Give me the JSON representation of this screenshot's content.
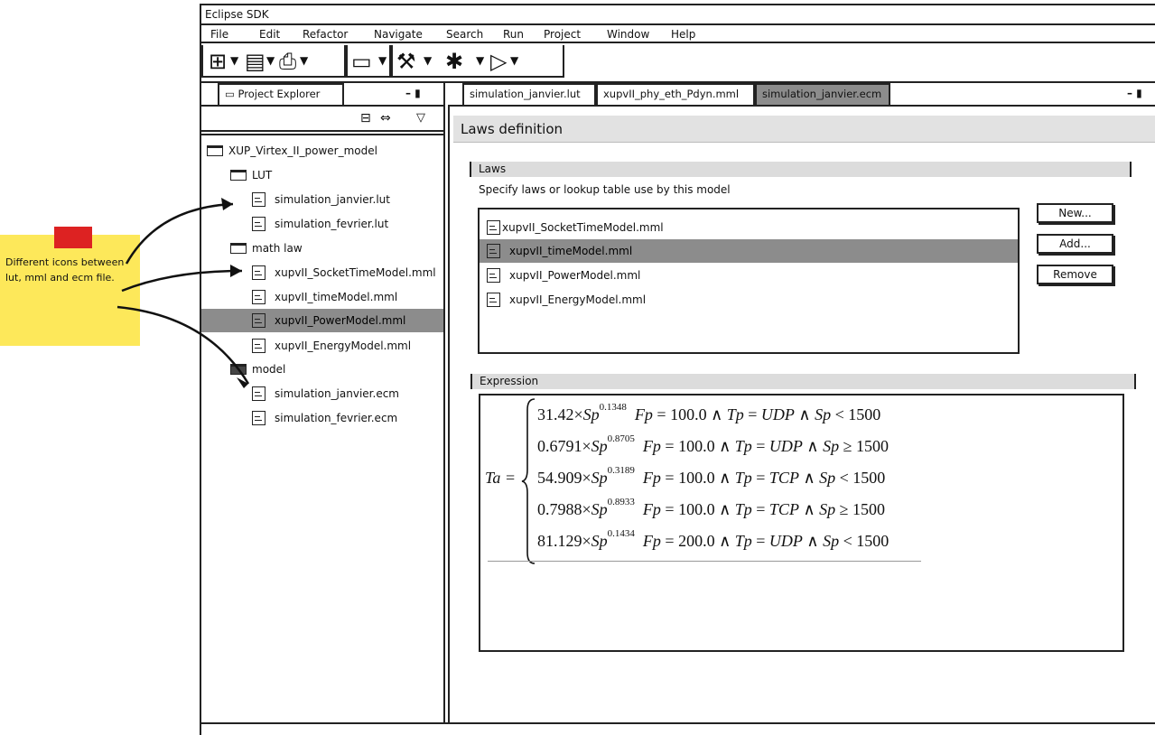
{
  "window": {
    "title": "Eclipse SDK"
  },
  "menu": [
    "File",
    "Edit",
    "Refactor",
    "Navigate",
    "Search",
    "Run",
    "Project",
    "Window",
    "Help"
  ],
  "left_panel": {
    "tab": "Project Explorer",
    "tree": [
      {
        "label": "XUP_Virtex_II_power_model",
        "type": "folder"
      },
      {
        "label": "LUT",
        "type": "folder"
      },
      {
        "label": "simulation_janvier.lut",
        "type": "file"
      },
      {
        "label": "simulation_fevrier.lut",
        "type": "file"
      },
      {
        "label": "math law",
        "type": "folder"
      },
      {
        "label": "xupvII_SocketTimeModel.mml",
        "type": "file"
      },
      {
        "label": "xupvII_timeModel.mml",
        "type": "file"
      },
      {
        "label": "xupvII_PowerModel.mml",
        "type": "file",
        "selected": true
      },
      {
        "label": "xupvII_EnergyModel.mml",
        "type": "file"
      },
      {
        "label": "model",
        "type": "folder"
      },
      {
        "label": "simulation_janvier.ecm",
        "type": "file"
      },
      {
        "label": "simulation_fevrier.ecm",
        "type": "file"
      }
    ]
  },
  "editor": {
    "tabs": [
      "simulation_janvier.lut",
      "xupvII_phy_eth_Pdyn.mml",
      "simulation_janvier.ecm"
    ],
    "header": "Laws definition",
    "laws": {
      "section": "Laws",
      "description": "Specify laws or lookup table use by this model",
      "items": [
        "xupvII_SocketTimeModel.mml",
        "xupvII_timeModel.mml",
        "xupvII_PowerModel.mml",
        "xupvII_EnergyModel.mml"
      ],
      "buttons": {
        "new": "New...",
        "add": "Add...",
        "remove": "Remove"
      }
    },
    "expression": {
      "section": "Expression",
      "lhs": "Ta =",
      "rows": [
        {
          "coef": "31.42",
          "exp": "0.1348",
          "fp": "100.0",
          "tp": "UDP",
          "cmp": "<",
          "thr": "1500"
        },
        {
          "coef": "0.6791",
          "exp": "0.8705",
          "fp": "100.0",
          "tp": "UDP",
          "cmp": "≥",
          "thr": "1500"
        },
        {
          "coef": "54.909",
          "exp": "0.3189",
          "fp": "100.0",
          "tp": "TCP",
          "cmp": "<",
          "thr": "1500"
        },
        {
          "coef": "0.7988",
          "exp": "0.8933",
          "fp": "100.0",
          "tp": "TCP",
          "cmp": "≥",
          "thr": "1500"
        },
        {
          "coef": "81.129",
          "exp": "0.1434",
          "fp": "200.0",
          "tp": "UDP",
          "cmp": "<",
          "thr": "1500"
        }
      ]
    }
  },
  "note": {
    "text": "Different icons between lut, mml and ecm file."
  },
  "colors": {
    "selection": "#8c8c8c",
    "note": "#fde85a",
    "pin": "#d22222"
  }
}
